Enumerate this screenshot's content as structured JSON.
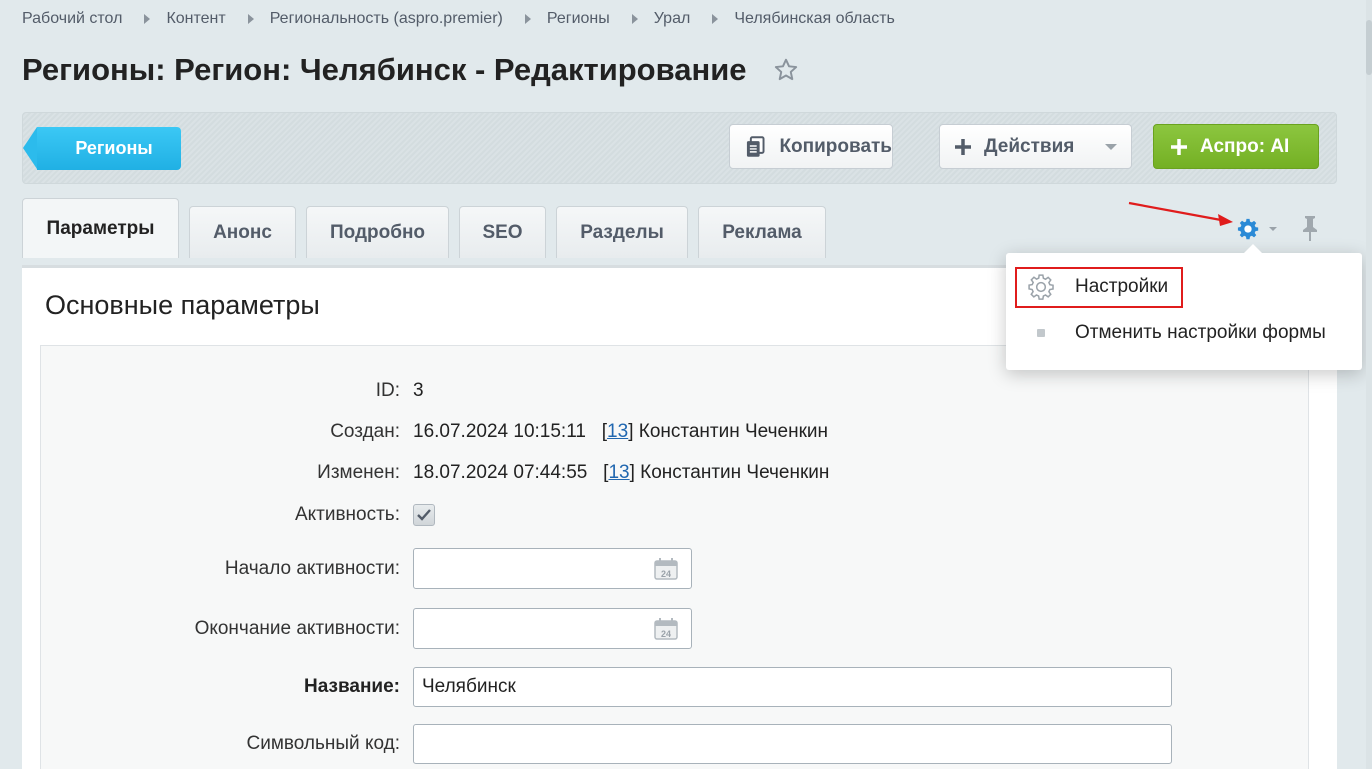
{
  "breadcrumbs": [
    "Рабочий стол",
    "Контент",
    "Региональность (aspro.premier)",
    "Регионы",
    "Урал",
    "Челябинская область"
  ],
  "page_title": "Регионы: Регион: Челябинск - Редактирование",
  "toolbar": {
    "back_label": "Регионы",
    "copy_label": "Копировать",
    "actions_label": "Действия",
    "ai_label": "Аспро: AI"
  },
  "tabs": [
    "Параметры",
    "Анонс",
    "Подробно",
    "SEO",
    "Разделы",
    "Реклама"
  ],
  "active_tab": "Параметры",
  "settings_menu": {
    "item_settings": "Настройки",
    "item_reset": "Отменить настройки формы"
  },
  "section_title": "Основные параметры",
  "fields": {
    "id_label": "ID:",
    "id_value": "3",
    "created_label": "Создан:",
    "created_date": "16.07.2024 10:15:11",
    "created_user_id": "13",
    "created_user": "Константин Чеченкин",
    "modified_label": "Изменен:",
    "modified_date": "18.07.2024 07:44:55",
    "modified_user_id": "13",
    "modified_user": "Константин Чеченкин",
    "active_label": "Активность:",
    "active_checked": true,
    "start_label": "Начало активности:",
    "end_label": "Окончание активности:",
    "calendar_day": "24",
    "name_label": "Название:",
    "name_value": "Челябинск",
    "code_label": "Символьный код:",
    "code_value": ""
  },
  "colors": {
    "accent_blue": "#2cbbec",
    "ai_green": "#7cb82f",
    "annotation_red": "#e01c1c",
    "gear_blue": "#2b8ad6"
  }
}
